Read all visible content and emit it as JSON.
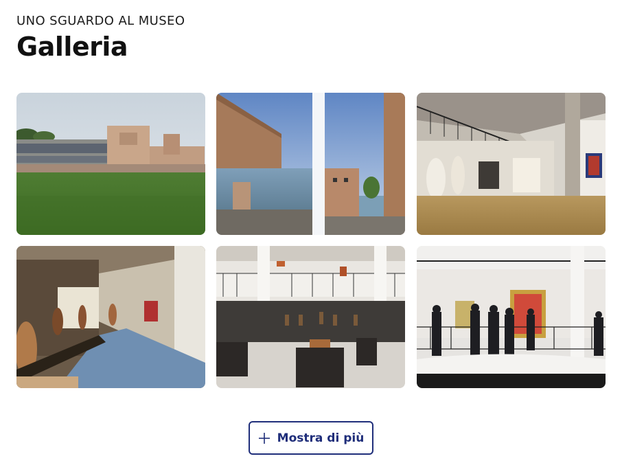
{
  "section": {
    "eyebrow": "UNO SGUARDO AL MUSEO",
    "title": "Galleria"
  },
  "gallery": {
    "items": [
      {
        "name": "exterior-lawn-photo"
      },
      {
        "name": "exterior-water-photo"
      },
      {
        "name": "interior-balcony-photo"
      },
      {
        "name": "interior-corridor-photo"
      },
      {
        "name": "interior-hall-photo"
      },
      {
        "name": "interior-gallery-visitors-photo"
      }
    ]
  },
  "actions": {
    "show_more_label": "Mostra di più",
    "show_more_icon": "plus-icon",
    "accent_color": "#1f2e7a"
  }
}
